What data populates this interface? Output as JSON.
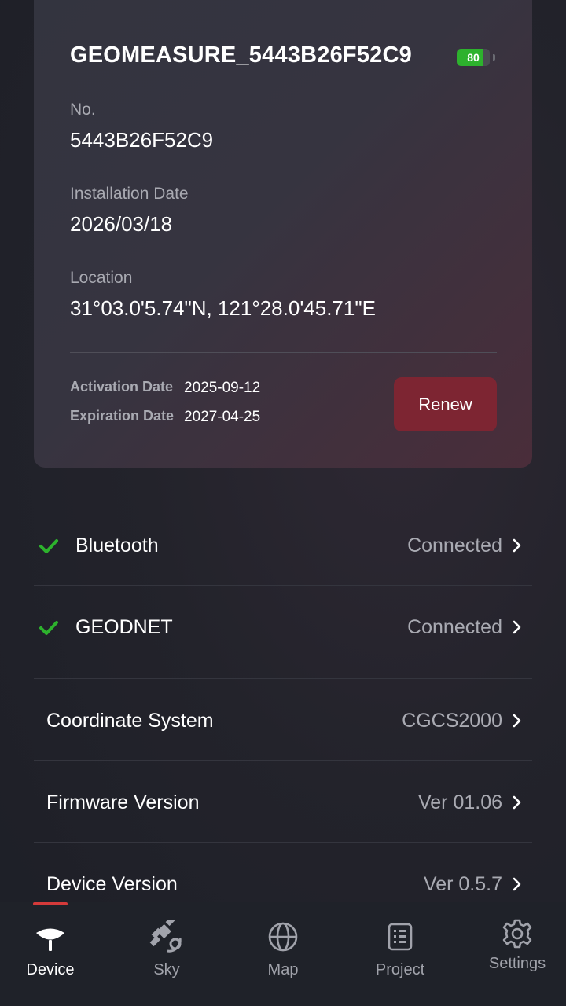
{
  "device": {
    "name": "GEOMEASURE_5443B26F52C9",
    "battery_level": "80",
    "battery_fraction": 0.8,
    "fields": [
      {
        "label": "No.",
        "value": "5443B26F52C9"
      },
      {
        "label": "Installation Date",
        "value": "2026/03/18"
      },
      {
        "label": "Location",
        "value": "31°03.0'5.74\"N, 121°28.0'45.71\"E"
      }
    ],
    "activation_label": "Activation Date",
    "activation_value": "2025-09-12",
    "expiration_label": "Expiration Date",
    "expiration_value": "2027-04-25",
    "renew_label": "Renew"
  },
  "settings": [
    {
      "title": "Bluetooth",
      "value": "Connected",
      "icon": "check-icon"
    },
    {
      "title": "GEODNET",
      "value": "Connected",
      "icon": "check-icon"
    },
    {
      "title": "Coordinate System",
      "value": "CGCS2000"
    },
    {
      "title": "Firmware Version",
      "value": "Ver 01.06"
    },
    {
      "title": "Device Version",
      "value": "Ver 0.5.7"
    }
  ],
  "tabs": [
    {
      "label": "Device",
      "icon": "receiver-icon",
      "active": true
    },
    {
      "label": "Sky",
      "icon": "satellite-icon"
    },
    {
      "label": "Map",
      "icon": "globe-icon"
    },
    {
      "label": "Project",
      "icon": "document-list-icon"
    },
    {
      "label": "Settings",
      "icon": "gear-icon"
    }
  ],
  "colors": {
    "accent": "#d43a3a",
    "renew_button": "#7d2532",
    "connected_check": "#2db22d",
    "battery_fill": "#2db22d"
  }
}
